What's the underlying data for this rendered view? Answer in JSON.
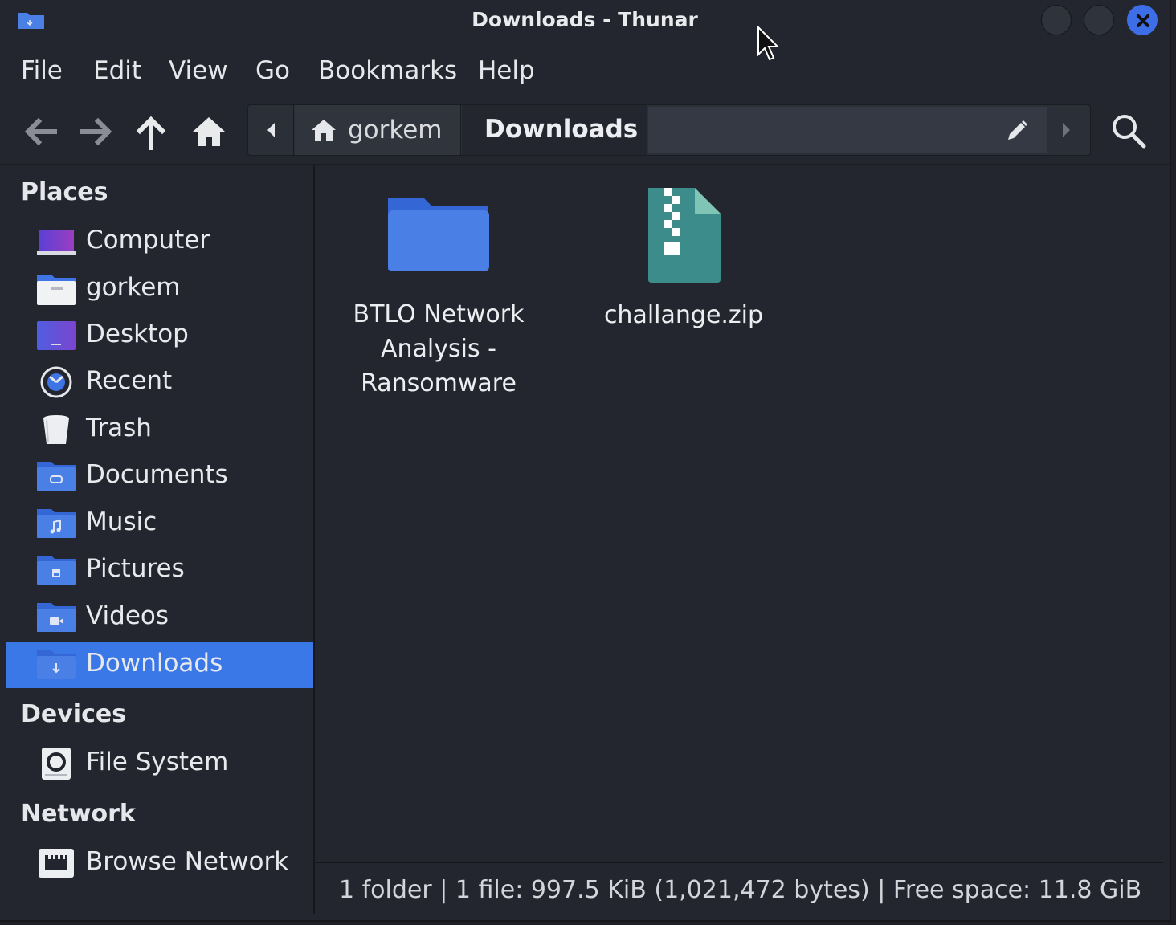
{
  "window": {
    "title": "Downloads - Thunar",
    "accent": "#3b78e7"
  },
  "menubar": {
    "items": [
      "File",
      "Edit",
      "View",
      "Go",
      "Bookmarks",
      "Help"
    ]
  },
  "toolbar": {
    "back_icon": "arrow-left-icon",
    "forward_icon": "arrow-right-icon",
    "up_icon": "arrow-up-icon",
    "home_icon": "home-icon",
    "path": [
      "gorkem",
      "Downloads"
    ],
    "edit_icon": "pencil-icon",
    "search_icon": "search-icon"
  },
  "sidebar": {
    "places_title": "Places",
    "places": [
      {
        "label": "Computer",
        "icon": "computer-icon"
      },
      {
        "label": "gorkem",
        "icon": "home-folder-icon"
      },
      {
        "label": "Desktop",
        "icon": "desktop-icon"
      },
      {
        "label": "Recent",
        "icon": "recent-icon"
      },
      {
        "label": "Trash",
        "icon": "trash-icon"
      },
      {
        "label": "Documents",
        "icon": "documents-folder-icon"
      },
      {
        "label": "Music",
        "icon": "music-folder-icon"
      },
      {
        "label": "Pictures",
        "icon": "pictures-folder-icon"
      },
      {
        "label": "Videos",
        "icon": "videos-folder-icon"
      },
      {
        "label": "Downloads",
        "icon": "downloads-folder-icon",
        "selected": true
      }
    ],
    "devices_title": "Devices",
    "devices": [
      {
        "label": "File System",
        "icon": "drive-icon"
      }
    ],
    "network_title": "Network",
    "network": [
      {
        "label": "Browse Network",
        "icon": "network-icon"
      }
    ]
  },
  "files": [
    {
      "name_lines": [
        "BTLO Network",
        "Analysis -",
        "Ransomware"
      ],
      "icon": "folder-icon"
    },
    {
      "name_lines": [
        "challange.zip"
      ],
      "icon": "zip-archive-icon"
    }
  ],
  "statusbar": {
    "text": "1 folder  |  1 file: 997.5 KiB (1,021,472 bytes)  |  Free space: 11.8 GiB"
  }
}
